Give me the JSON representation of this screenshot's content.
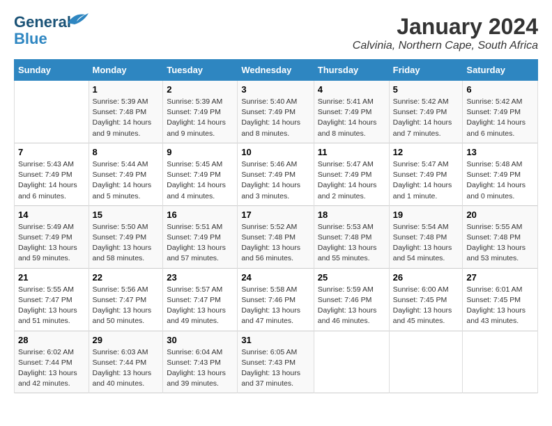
{
  "logo": {
    "line1": "General",
    "line2": "Blue"
  },
  "title": {
    "month": "January 2024",
    "location": "Calvinia, Northern Cape, South Africa"
  },
  "days_of_week": [
    "Sunday",
    "Monday",
    "Tuesday",
    "Wednesday",
    "Thursday",
    "Friday",
    "Saturday"
  ],
  "weeks": [
    {
      "days": [
        {
          "number": "",
          "sunrise": "",
          "sunset": "",
          "daylight": ""
        },
        {
          "number": "1",
          "sunrise": "Sunrise: 5:39 AM",
          "sunset": "Sunset: 7:48 PM",
          "daylight": "Daylight: 14 hours and 9 minutes."
        },
        {
          "number": "2",
          "sunrise": "Sunrise: 5:39 AM",
          "sunset": "Sunset: 7:49 PM",
          "daylight": "Daylight: 14 hours and 9 minutes."
        },
        {
          "number": "3",
          "sunrise": "Sunrise: 5:40 AM",
          "sunset": "Sunset: 7:49 PM",
          "daylight": "Daylight: 14 hours and 8 minutes."
        },
        {
          "number": "4",
          "sunrise": "Sunrise: 5:41 AM",
          "sunset": "Sunset: 7:49 PM",
          "daylight": "Daylight: 14 hours and 8 minutes."
        },
        {
          "number": "5",
          "sunrise": "Sunrise: 5:42 AM",
          "sunset": "Sunset: 7:49 PM",
          "daylight": "Daylight: 14 hours and 7 minutes."
        },
        {
          "number": "6",
          "sunrise": "Sunrise: 5:42 AM",
          "sunset": "Sunset: 7:49 PM",
          "daylight": "Daylight: 14 hours and 6 minutes."
        }
      ]
    },
    {
      "days": [
        {
          "number": "7",
          "sunrise": "Sunrise: 5:43 AM",
          "sunset": "Sunset: 7:49 PM",
          "daylight": "Daylight: 14 hours and 6 minutes."
        },
        {
          "number": "8",
          "sunrise": "Sunrise: 5:44 AM",
          "sunset": "Sunset: 7:49 PM",
          "daylight": "Daylight: 14 hours and 5 minutes."
        },
        {
          "number": "9",
          "sunrise": "Sunrise: 5:45 AM",
          "sunset": "Sunset: 7:49 PM",
          "daylight": "Daylight: 14 hours and 4 minutes."
        },
        {
          "number": "10",
          "sunrise": "Sunrise: 5:46 AM",
          "sunset": "Sunset: 7:49 PM",
          "daylight": "Daylight: 14 hours and 3 minutes."
        },
        {
          "number": "11",
          "sunrise": "Sunrise: 5:47 AM",
          "sunset": "Sunset: 7:49 PM",
          "daylight": "Daylight: 14 hours and 2 minutes."
        },
        {
          "number": "12",
          "sunrise": "Sunrise: 5:47 AM",
          "sunset": "Sunset: 7:49 PM",
          "daylight": "Daylight: 14 hours and 1 minute."
        },
        {
          "number": "13",
          "sunrise": "Sunrise: 5:48 AM",
          "sunset": "Sunset: 7:49 PM",
          "daylight": "Daylight: 14 hours and 0 minutes."
        }
      ]
    },
    {
      "days": [
        {
          "number": "14",
          "sunrise": "Sunrise: 5:49 AM",
          "sunset": "Sunset: 7:49 PM",
          "daylight": "Daylight: 13 hours and 59 minutes."
        },
        {
          "number": "15",
          "sunrise": "Sunrise: 5:50 AM",
          "sunset": "Sunset: 7:49 PM",
          "daylight": "Daylight: 13 hours and 58 minutes."
        },
        {
          "number": "16",
          "sunrise": "Sunrise: 5:51 AM",
          "sunset": "Sunset: 7:49 PM",
          "daylight": "Daylight: 13 hours and 57 minutes."
        },
        {
          "number": "17",
          "sunrise": "Sunrise: 5:52 AM",
          "sunset": "Sunset: 7:48 PM",
          "daylight": "Daylight: 13 hours and 56 minutes."
        },
        {
          "number": "18",
          "sunrise": "Sunrise: 5:53 AM",
          "sunset": "Sunset: 7:48 PM",
          "daylight": "Daylight: 13 hours and 55 minutes."
        },
        {
          "number": "19",
          "sunrise": "Sunrise: 5:54 AM",
          "sunset": "Sunset: 7:48 PM",
          "daylight": "Daylight: 13 hours and 54 minutes."
        },
        {
          "number": "20",
          "sunrise": "Sunrise: 5:55 AM",
          "sunset": "Sunset: 7:48 PM",
          "daylight": "Daylight: 13 hours and 53 minutes."
        }
      ]
    },
    {
      "days": [
        {
          "number": "21",
          "sunrise": "Sunrise: 5:55 AM",
          "sunset": "Sunset: 7:47 PM",
          "daylight": "Daylight: 13 hours and 51 minutes."
        },
        {
          "number": "22",
          "sunrise": "Sunrise: 5:56 AM",
          "sunset": "Sunset: 7:47 PM",
          "daylight": "Daylight: 13 hours and 50 minutes."
        },
        {
          "number": "23",
          "sunrise": "Sunrise: 5:57 AM",
          "sunset": "Sunset: 7:47 PM",
          "daylight": "Daylight: 13 hours and 49 minutes."
        },
        {
          "number": "24",
          "sunrise": "Sunrise: 5:58 AM",
          "sunset": "Sunset: 7:46 PM",
          "daylight": "Daylight: 13 hours and 47 minutes."
        },
        {
          "number": "25",
          "sunrise": "Sunrise: 5:59 AM",
          "sunset": "Sunset: 7:46 PM",
          "daylight": "Daylight: 13 hours and 46 minutes."
        },
        {
          "number": "26",
          "sunrise": "Sunrise: 6:00 AM",
          "sunset": "Sunset: 7:45 PM",
          "daylight": "Daylight: 13 hours and 45 minutes."
        },
        {
          "number": "27",
          "sunrise": "Sunrise: 6:01 AM",
          "sunset": "Sunset: 7:45 PM",
          "daylight": "Daylight: 13 hours and 43 minutes."
        }
      ]
    },
    {
      "days": [
        {
          "number": "28",
          "sunrise": "Sunrise: 6:02 AM",
          "sunset": "Sunset: 7:44 PM",
          "daylight": "Daylight: 13 hours and 42 minutes."
        },
        {
          "number": "29",
          "sunrise": "Sunrise: 6:03 AM",
          "sunset": "Sunset: 7:44 PM",
          "daylight": "Daylight: 13 hours and 40 minutes."
        },
        {
          "number": "30",
          "sunrise": "Sunrise: 6:04 AM",
          "sunset": "Sunset: 7:43 PM",
          "daylight": "Daylight: 13 hours and 39 minutes."
        },
        {
          "number": "31",
          "sunrise": "Sunrise: 6:05 AM",
          "sunset": "Sunset: 7:43 PM",
          "daylight": "Daylight: 13 hours and 37 minutes."
        },
        {
          "number": "",
          "sunrise": "",
          "sunset": "",
          "daylight": ""
        },
        {
          "number": "",
          "sunrise": "",
          "sunset": "",
          "daylight": ""
        },
        {
          "number": "",
          "sunrise": "",
          "sunset": "",
          "daylight": ""
        }
      ]
    }
  ]
}
